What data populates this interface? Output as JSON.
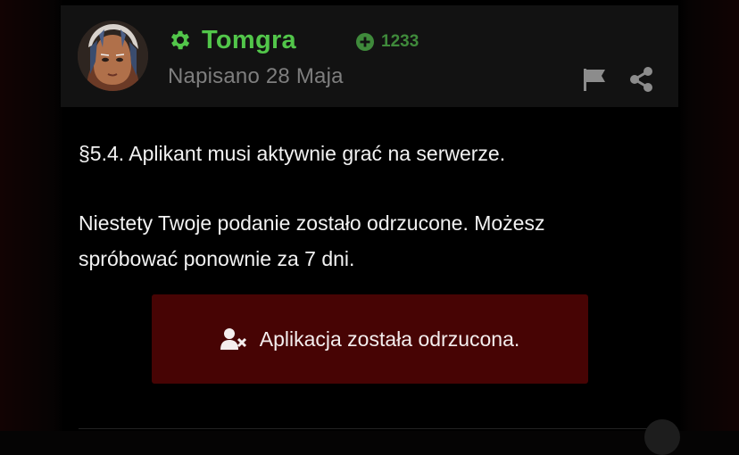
{
  "post": {
    "author": {
      "name": "Tomgra",
      "reputation": "1233",
      "badge_icon": "gear-icon",
      "name_color": "#52c64a",
      "rep_color": "#3f8a3b"
    },
    "date": "Napisano 28 Maja",
    "actions": {
      "report_icon": "flag-icon",
      "share_icon": "share-icon"
    },
    "body": {
      "paragraph_1": "§5.4. Aplikant musi aktywnie grać na serwerze.",
      "paragraph_2_line_1": "Niestety Twoje podanie zostało odrzucone. Możesz",
      "paragraph_2_line_2": "spróbować ponownie za 7 dni."
    },
    "status": {
      "label": "Aplikacja została odrzucona.",
      "icon": "user-times-icon",
      "background": "#470404"
    }
  }
}
